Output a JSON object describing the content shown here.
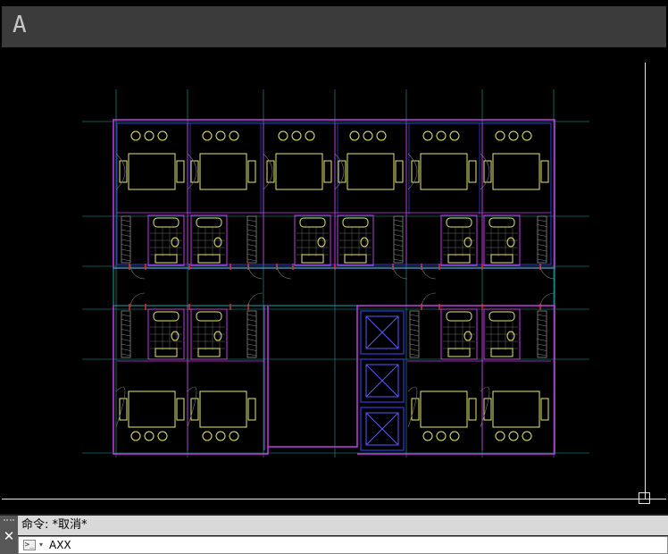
{
  "app": {
    "logo_letter": "A"
  },
  "command_line": {
    "history": "命令: *取消*",
    "input_value": "AXX",
    "close_glyph": "✕",
    "prompt_glyph": ">_",
    "dropdown_glyph": "▾"
  },
  "colors": {
    "background": "#000000",
    "grid_axis": "#1aa3a3",
    "wall_outline": "#c040e0",
    "wall_inner": "#3a3ad8",
    "furniture": "#e8e870",
    "door_marker": "#e03030"
  }
}
